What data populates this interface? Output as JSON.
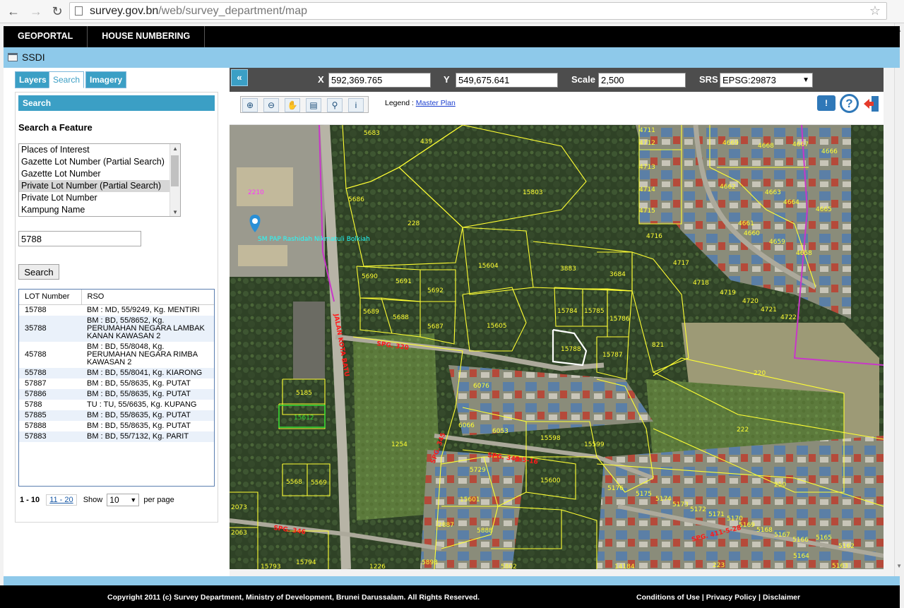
{
  "browser": {
    "url_host": "survey.gov.bn",
    "url_path": "/web/survey_department/map"
  },
  "topnav": {
    "items": [
      "GEOPORTAL",
      "HOUSE NUMBERING"
    ]
  },
  "app": {
    "title": "SSDI"
  },
  "tabs": [
    "Layers",
    "Search",
    "Imagery"
  ],
  "search": {
    "header": "Search",
    "feature_title": "Search a Feature",
    "feature_options": [
      "Places of Interest",
      "Gazette Lot Number (Partial Search)",
      "Gazette Lot Number",
      "Private Lot Number (Partial Search)",
      "Private Lot Number",
      "Kampung Name"
    ],
    "selected_index": 3,
    "query": "5788",
    "button_label": "Search"
  },
  "results": {
    "columns": [
      "LOT Number",
      "RSO"
    ],
    "rows": [
      [
        "15788",
        "BM : MD, 55/9249, Kg. MENTIRI"
      ],
      [
        "35788",
        "BM : BD, 55/8652, Kg. PERUMAHAN NEGARA LAMBAK KANAN KAWASAN 2"
      ],
      [
        "45788",
        "BM : BD, 55/8048, Kg. PERUMAHAN NEGARA RIMBA KAWASAN 2"
      ],
      [
        "55788",
        "BM : BD, 55/8041, Kg. KIARONG"
      ],
      [
        "57887",
        "BM : BD, 55/8635, Kg. PUTAT"
      ],
      [
        "57886",
        "BM : BD, 55/8635, Kg. PUTAT"
      ],
      [
        "5788",
        "TU : TU, 55/6635, Kg. KUPANG"
      ],
      [
        "57885",
        "BM : BD, 55/8635, Kg. PUTAT"
      ],
      [
        "57888",
        "BM : BD, 55/8635, Kg. PUTAT"
      ],
      [
        "57883",
        "BM : BD, 55/7132, Kg. PARIT"
      ]
    ]
  },
  "pager": {
    "current": "1 - 10",
    "next": "11 - 20",
    "show_label": "Show",
    "page_size": "10",
    "per_page_label": "per page"
  },
  "map_controls": {
    "x_label": "X",
    "x_value": "592,369.765",
    "y_label": "Y",
    "y_value": "549,675.641",
    "scale_label": "Scale",
    "scale_value": "2,500",
    "srs_label": "SRS",
    "srs_value": "EPSG:29873",
    "collapse": "«",
    "legend_label": "Legend :",
    "legend_link": "Master Plan"
  },
  "map": {
    "poi_label": "SM PAP Rashidah Nikmatuli Bolkiah",
    "road_labels": [
      "JALAN KOTA BATU",
      "SPG. 320",
      "SPG. 345-5-16",
      "SPG. 345",
      "SPG. 411-5-28",
      "SPG. 346"
    ],
    "lots": [
      "5683",
      "439",
      "15803",
      "5686",
      "2210",
      "228",
      "15604",
      "3883",
      "3684",
      "5690",
      "5691",
      "5692",
      "15784",
      "15785",
      "15786",
      "5689",
      "5688",
      "5687",
      "15605",
      "15788",
      "15787",
      "821",
      "220",
      "5185",
      "15612",
      "6076",
      "6053",
      "15598",
      "15599",
      "1254",
      "222",
      "6066",
      "5729",
      "15601",
      "15600",
      "5176",
      "5175",
      "5174",
      "5173",
      "5172",
      "5171",
      "5170",
      "5169",
      "5168",
      "5167",
      "5166",
      "5165",
      "5164",
      "5163",
      "5162",
      "250",
      "5568",
      "5569",
      "2887",
      "5888",
      "2073",
      "2063",
      "15794",
      "1226",
      "5898",
      "5802",
      "14184",
      "223",
      "15793",
      "4711",
      "4712",
      "4713",
      "4714",
      "4715",
      "4716",
      "4717",
      "4718",
      "4719",
      "4720",
      "4721",
      "4722",
      "4669",
      "4668",
      "4667",
      "4666",
      "4665",
      "4664",
      "4663",
      "4662",
      "4661",
      "4660",
      "4659",
      "4658"
    ]
  },
  "colors": {
    "accent": "#3b9fc5",
    "bar_blue": "#8ec9ea",
    "lot_line": "#ffff33",
    "road_red": "#ff1a1a",
    "boundary": "#c837c8"
  },
  "footer": {
    "copyright": "Copyright 2011 (c) Survey Department, Ministry of Development, Brunei Darussalam. All Rights Reserved.",
    "links": [
      "Conditions of Use",
      "Privacy Policy",
      "Disclaimer"
    ]
  }
}
